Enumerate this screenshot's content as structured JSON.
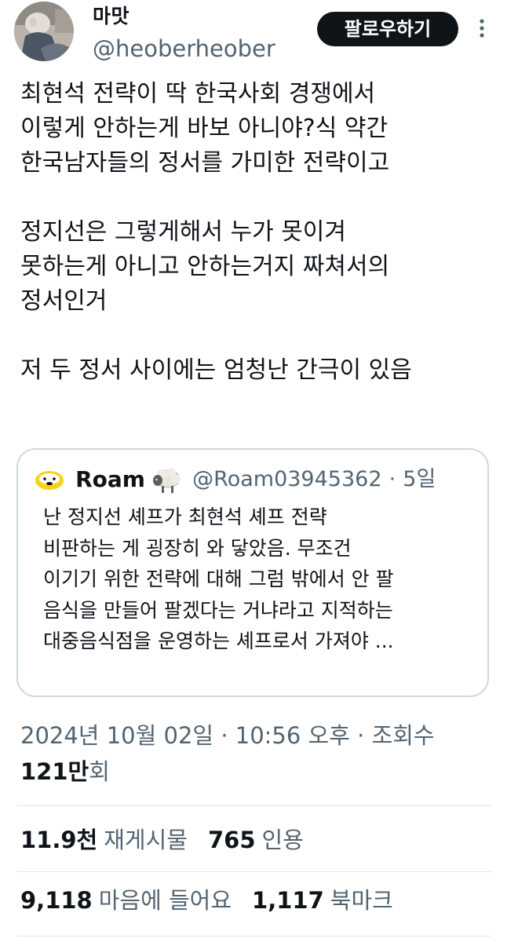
{
  "author": {
    "display_name": "마맛",
    "handle": "@heoberheober",
    "follow_label": "팔로우하기"
  },
  "tweet": {
    "paragraphs": [
      [
        "최현석 전략이 딱 한국사회 경쟁에서",
        "이렇게 안하는게 바보 아니야?식 약간",
        "한국남자들의 정서를 가미한 전략이고"
      ],
      [
        "정지선은 그렇게해서 누가 못이겨",
        "못하는게 아니고 안하는거지 짜쳐서의",
        "정서인거"
      ],
      [
        "저 두 정서 사이에는 엄청난 간극이 있음"
      ]
    ]
  },
  "quote": {
    "name": "Roam",
    "handle": "@Roam03945362",
    "separator": "·",
    "time": "5일",
    "lines": [
      "난 정지선 셰프가 최현석 셰프 전략",
      "비판하는 게 굉장히 와 닿았음. 무조건",
      "이기기 위한 전략에 대해 그럼 밖에서 안 팔",
      "음식을 만들어 팔겠다는 거냐라고 지적하는",
      "대중음식점을 운영하는 셰프로서 가져야 ..."
    ]
  },
  "meta": {
    "date": "2024년 10월 02일",
    "time": "10:56 오후",
    "views_label": "조회수",
    "views_count": "121만",
    "views_unit": "회",
    "separator": "·"
  },
  "stats": {
    "reposts": {
      "count": "11.9천",
      "label": "재게시물"
    },
    "quotes": {
      "count": "765",
      "label": "인용"
    },
    "likes": {
      "count": "9,118",
      "label": "마음에 들어요"
    },
    "bookmarks": {
      "count": "1,117",
      "label": "북마크"
    }
  },
  "icons": {
    "more": "more-dots-icon",
    "quote_avatar": "sheep-face-icon",
    "quote_emoji": "sheep-emoji-icon"
  },
  "colors": {
    "text": "#0f1419",
    "secondary": "#536471",
    "border": "#cfd9de",
    "button_bg": "#0f1419"
  }
}
